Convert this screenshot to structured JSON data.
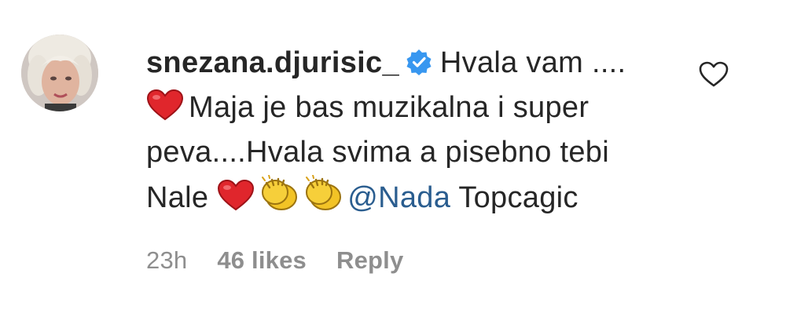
{
  "comment": {
    "username": "snezana.djurisic_",
    "avatar_icon": "profile-photo",
    "verified_icon": "verified-badge-icon",
    "text_part1": "Hvala vam ....",
    "text_part2": "Maja je bas muzikalna i super peva....Hvala svima a pisebno tebi Nale",
    "mention": "@Nada",
    "text_part3": "Topcagic",
    "timestamp": "23h",
    "likes": "46 likes",
    "reply_label": "Reply",
    "like_icon": "heart-outline-icon",
    "emojis": [
      "red-heart-emoji",
      "red-heart-emoji",
      "clapping-hands-emoji",
      "clapping-hands-emoji"
    ]
  },
  "colors": {
    "text": "#262626",
    "muted": "#8e8e8e",
    "mention": "#2a5d8f",
    "verified": "#3897f0",
    "heart": "#e0262c",
    "clap": "#f2c326"
  }
}
